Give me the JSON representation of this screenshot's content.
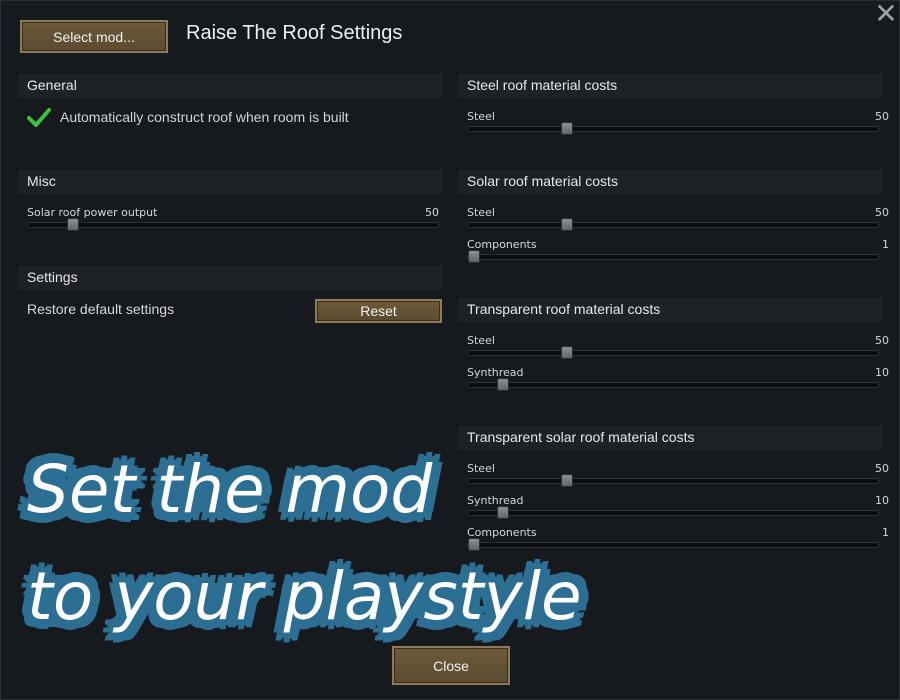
{
  "window": {
    "title": "Raise The Roof Settings",
    "select_mod_label": "Select mod...",
    "close_label": "Close",
    "close_icon": "close-x-icon"
  },
  "left": {
    "general": {
      "header": "General",
      "auto_construct": {
        "label": "Automatically construct roof when room is built",
        "checked": true
      }
    },
    "misc": {
      "header": "Misc",
      "solar_power": {
        "label": "Solar roof power output",
        "value": "50",
        "fraction": 0.11
      }
    },
    "settings": {
      "header": "Settings",
      "restore_label": "Restore default settings",
      "reset_label": "Reset"
    }
  },
  "right": {
    "steel_roof": {
      "header": "Steel roof material costs",
      "sliders": [
        {
          "label": "Steel",
          "value": "50",
          "fraction": 0.24
        }
      ]
    },
    "solar_roof": {
      "header": "Solar roof material costs",
      "sliders": [
        {
          "label": "Steel",
          "value": "50",
          "fraction": 0.24
        },
        {
          "label": "Components",
          "value": "1",
          "fraction": 0.0
        }
      ]
    },
    "transparent_roof": {
      "header": "Transparent roof material costs",
      "sliders": [
        {
          "label": "Steel",
          "value": "50",
          "fraction": 0.24
        },
        {
          "label": "Synthread",
          "value": "10",
          "fraction": 0.085
        }
      ]
    },
    "transparent_solar_roof": {
      "header": "Transparent solar roof material costs",
      "sliders": [
        {
          "label": "Steel",
          "value": "50",
          "fraction": 0.24
        },
        {
          "label": "Synthread",
          "value": "10",
          "fraction": 0.085
        },
        {
          "label": "Components",
          "value": "1",
          "fraction": 0.0
        }
      ]
    }
  },
  "overlay": {
    "line1": "Set the mod",
    "line2": "to your playstyle"
  },
  "colors": {
    "background": "#15181c",
    "section_header": "#1e2227",
    "button": "#6e5a3a",
    "check": "#3cc23c",
    "overlay_outline": "#2c6f93"
  }
}
